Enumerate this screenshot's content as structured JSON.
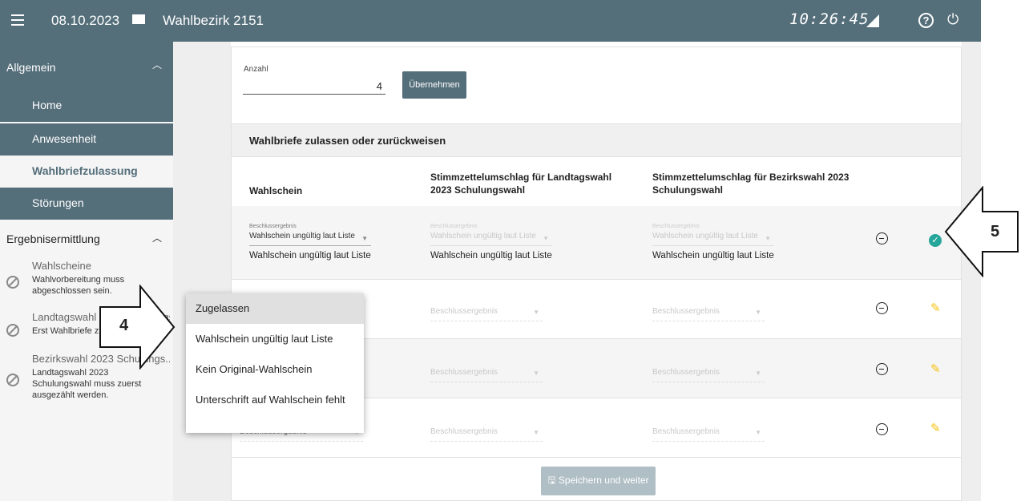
{
  "topbar": {
    "date": "08.10.2023",
    "district": "Wahlbezirk 2151",
    "clock": "10:26:45"
  },
  "sidebar": {
    "section1": "Allgemein",
    "items": [
      {
        "label": "Home"
      },
      {
        "label": "Anwesenheit"
      },
      {
        "label": "Wahlbriefzulassung"
      },
      {
        "label": "Störungen"
      }
    ],
    "section2": "Ergebnisermittlung",
    "sub": [
      {
        "title": "Wahlscheine",
        "desc": "Wahlvorbereitung muss abgeschlossen sein."
      },
      {
        "title": "Landtagswahl 2023 Schulungs...",
        "desc": "Erst Wahlbriefe zulassen"
      },
      {
        "title": "Bezirkswahl 2023 Schulungs...",
        "desc": "Landtagswahl 2023 Schulungswahl muss zuerst ausgezählt werden."
      }
    ]
  },
  "form": {
    "anzahl_label": "Anzahl",
    "anzahl_value": "4",
    "uebernehmen": "Übernehmen"
  },
  "table": {
    "section_title": "Wahlbriefe zulassen oder zurückweisen",
    "col1": "Wahlschein",
    "col2": "Stimmzettelumschlag für Landtagswahl 2023 Schulungswahl",
    "col3": "Stimmzettelumschlag für Bezirkswahl 2023 Schulungswahl",
    "row1": {
      "lbl": "Beschlussergebnis",
      "sel": "Wahlschein ungültig laut Liste",
      "val": "Wahlschein ungültig laut Liste"
    },
    "placeholder": "Beschlussergebnis"
  },
  "save_label": "Speichern und weiter",
  "dropdown": [
    "Zugelassen",
    "Wahlschein ungültig laut Liste",
    "Kein Original-Wahlschein",
    "Unterschrift auf Wahlschein fehlt"
  ],
  "callouts": {
    "a": "4",
    "b": "5"
  },
  "colors": {
    "header": "#546e7a",
    "check": "#26a69a",
    "pencil": "#f4c20d"
  }
}
